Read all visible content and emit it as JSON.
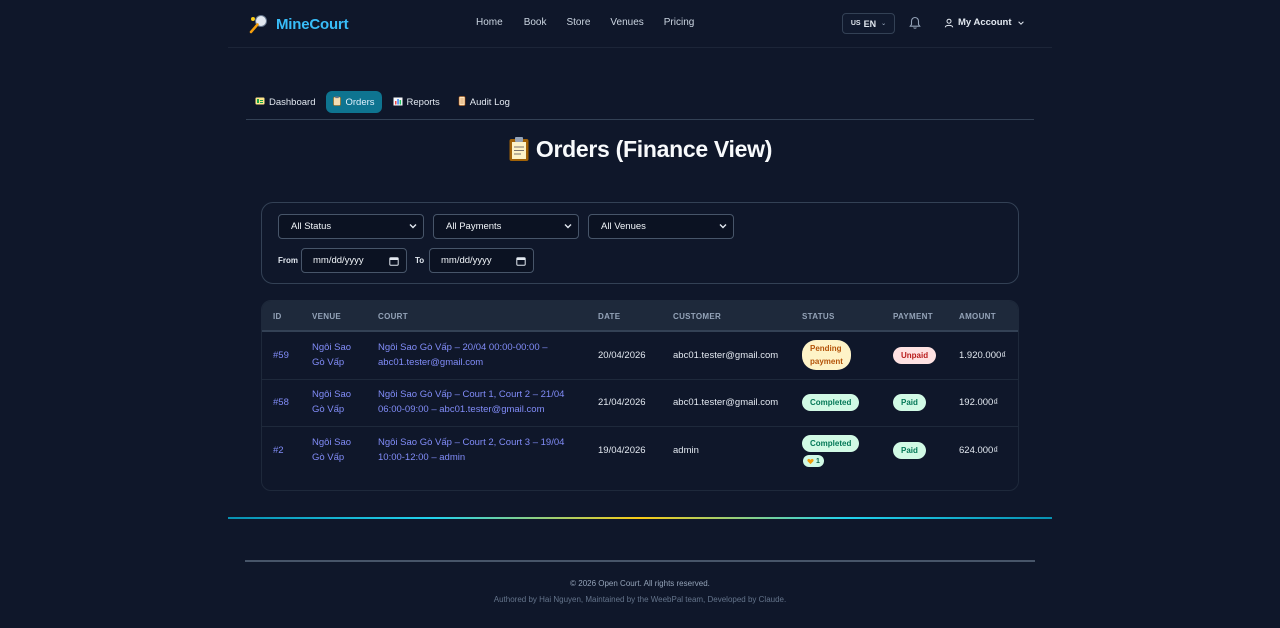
{
  "header": {
    "logo_text": "MineCourt",
    "nav": [
      "Home",
      "Book",
      "Store",
      "Venues",
      "Pricing"
    ],
    "language": {
      "flag": "US",
      "code": "EN"
    },
    "account_label": "My Account"
  },
  "tabs": [
    {
      "label": "Dashboard",
      "icon": "dashboard-icon",
      "active": false
    },
    {
      "label": "Orders",
      "icon": "clipboard-icon",
      "active": true
    },
    {
      "label": "Reports",
      "icon": "bar-chart-icon",
      "active": false
    },
    {
      "label": "Audit Log",
      "icon": "scroll-icon",
      "active": false
    }
  ],
  "page_title": "Orders (Finance View)",
  "filters": {
    "status": "All Status",
    "payments": "All Payments",
    "venues": "All Venues",
    "from_label": "From",
    "from_value": "mm/dd/yyyy",
    "to_label": "To",
    "to_value": "mm/dd/yyyy"
  },
  "table": {
    "columns": [
      "ID",
      "VENUE",
      "COURT",
      "DATE",
      "CUSTOMER",
      "STATUS",
      "PAYMENT",
      "AMOUNT"
    ],
    "rows": [
      {
        "id": "#59",
        "venue_l1": "Ngôi Sao",
        "venue_l2": "Gò Vấp",
        "court_l1": "Ngôi Sao Gò Vấp – 20/04 00:00-00:00 –",
        "court_l2": "abc01.tester@gmail.com",
        "date": "20/04/2026",
        "customer": "abc01.tester@gmail.com",
        "status_l1": "Pending",
        "status_l2": "payment",
        "payment": "Unpaid",
        "amount": "1.920.000₫"
      },
      {
        "id": "#58",
        "venue_l1": "Ngôi Sao",
        "venue_l2": "Gò Vấp",
        "court_l1": "Ngôi Sao Gò Vấp – Court 1, Court 2 – 21/04",
        "court_l2": "06:00-09:00 – abc01.tester@gmail.com",
        "date": "21/04/2026",
        "customer": "abc01.tester@gmail.com",
        "status": "Completed",
        "payment": "Paid",
        "amount": "192.000₫"
      },
      {
        "id": "#2",
        "venue_l1": "Ngôi Sao",
        "venue_l2": "Gò Vấp",
        "court_l1": "Ngôi Sao Gò Vấp – Court 2, Court 3 – 19/04",
        "court_l2": "10:00-12:00 – admin",
        "date": "19/04/2026",
        "customer": "admin",
        "status": "Completed",
        "review_count": "1",
        "payment": "Paid",
        "amount": "624.000₫"
      }
    ]
  },
  "footer": {
    "copyright": "© 2026 Open Court. All rights reserved.",
    "credits": "Authored by Hai Nguyen, Maintained by the WeebPal team, Developed by Claude."
  },
  "colors": {
    "background": "#0f172a",
    "accent": "#0e7490",
    "link": "#818cf8",
    "logo": "#38bdf8"
  }
}
